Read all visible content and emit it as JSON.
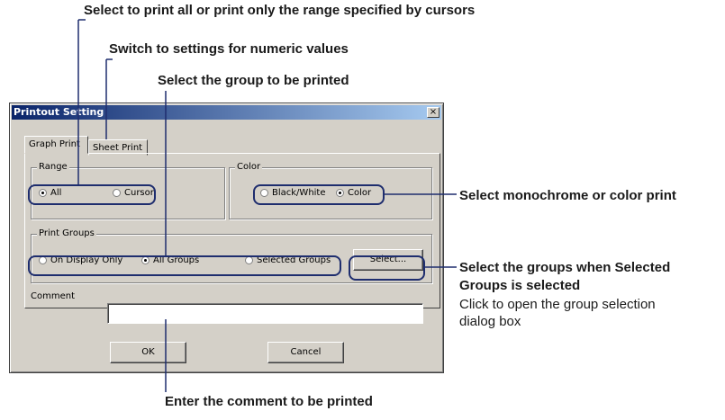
{
  "callouts": {
    "print_range": "Select to print all or print only the range specified by cursors",
    "numeric_settings": "Switch to settings for numeric values",
    "group_printed": "Select the group to be printed",
    "color_print": "Select monochrome or color print",
    "groups_when_selected_line1": "Select the groups when Selected",
    "groups_when_selected_line2": "Groups is selected",
    "open_dialog_line1": "Click to open the group selection",
    "open_dialog_line2": "dialog box",
    "comment_printed": "Enter the comment to be printed"
  },
  "dialog": {
    "title": "Printout Setting",
    "close": "×",
    "tabs": [
      "Graph Print",
      "Sheet Print"
    ],
    "range": {
      "legend": "Range",
      "options": [
        "All",
        "Cursor"
      ],
      "selected": "All"
    },
    "color": {
      "legend": "Color",
      "options": [
        "Black/White",
        "Color"
      ],
      "selected": "Color"
    },
    "print_groups": {
      "legend": "Print Groups",
      "options": [
        "On Display Only",
        "All Groups",
        "Selected Groups"
      ],
      "selected": "All Groups",
      "select_button": "Select..."
    },
    "comment": {
      "label": "Comment",
      "value": ""
    },
    "ok": "OK",
    "cancel": "Cancel"
  },
  "colors": {
    "titlebar_start": "#0a246a",
    "titlebar_end": "#a6caf0",
    "dialog_face": "#d4d0c8",
    "highlight": "#1e2d6e"
  }
}
